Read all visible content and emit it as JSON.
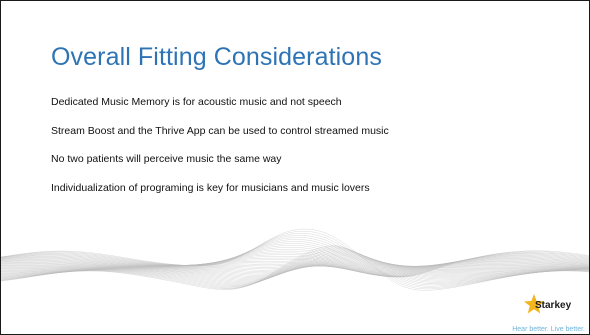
{
  "slide": {
    "title": "Overall Fitting Considerations",
    "bullets": [
      "Dedicated Music Memory is for acoustic music and not speech",
      "Stream Boost and the Thrive App can be used to control streamed music",
      "No two patients will perceive music the same way",
      "Individualization of programing is key for musicians and music lovers"
    ]
  },
  "logo": {
    "name": "Starkey",
    "tagline": "Hear better. Live better."
  },
  "colors": {
    "title": "#2e74b5",
    "logo_star": "#f2b51c",
    "tagline": "#6fb4d9"
  }
}
